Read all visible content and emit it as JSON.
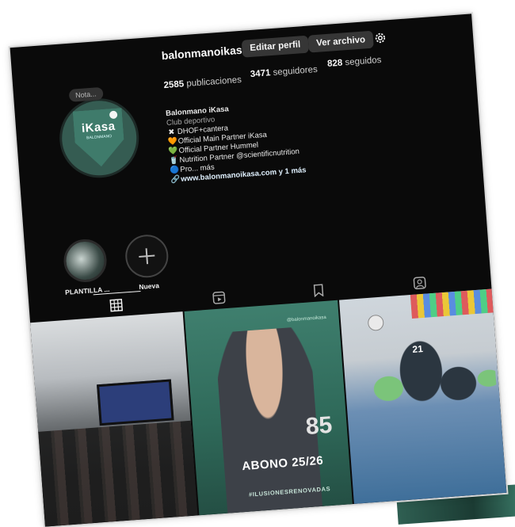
{
  "profile": {
    "username": "balonmanoikasa",
    "edit_label": "Editar perfil",
    "archive_label": "Ver archivo",
    "note_label": "Nota...",
    "avatar_text": "iKasa",
    "avatar_subtext": "BALONMANO"
  },
  "stats": {
    "posts_count": "2585",
    "posts_label": "publicaciones",
    "followers_count": "3471",
    "followers_label": "seguidores",
    "following_count": "828",
    "following_label": "seguidos"
  },
  "bio": {
    "name": "Balonmano iKasa",
    "category": "Club deportivo",
    "lines": [
      {
        "icon": "✖",
        "text": "DHOF+cantera"
      },
      {
        "icon": "🧡",
        "text": "Official Main Partner iKasa"
      },
      {
        "icon": "💚",
        "text": "Official Partner Hummel"
      },
      {
        "icon": "🥤",
        "text": "Nutrition Partner @scientificnutrition"
      },
      {
        "icon": "🔵",
        "text": "Pro... más"
      }
    ],
    "link_icon": "🔗",
    "link_text": "www.balonmanoikasa.com y 1 más"
  },
  "highlights": [
    {
      "label": "PLANTILLA ..."
    },
    {
      "label": "Nueva"
    }
  ],
  "posts": {
    "tile2_title": "ABONO 25/26",
    "tile2_hashtag": "#ILUSIONESRENOVADAS",
    "tile2_number": "85",
    "tile2_handle": "@balonmanoikasa",
    "tile3_number": "21"
  },
  "colors": {
    "background": "#0a0a0a",
    "button": "#363636",
    "text": "#f5f5f5",
    "brand_green": "#3f7b6b"
  }
}
